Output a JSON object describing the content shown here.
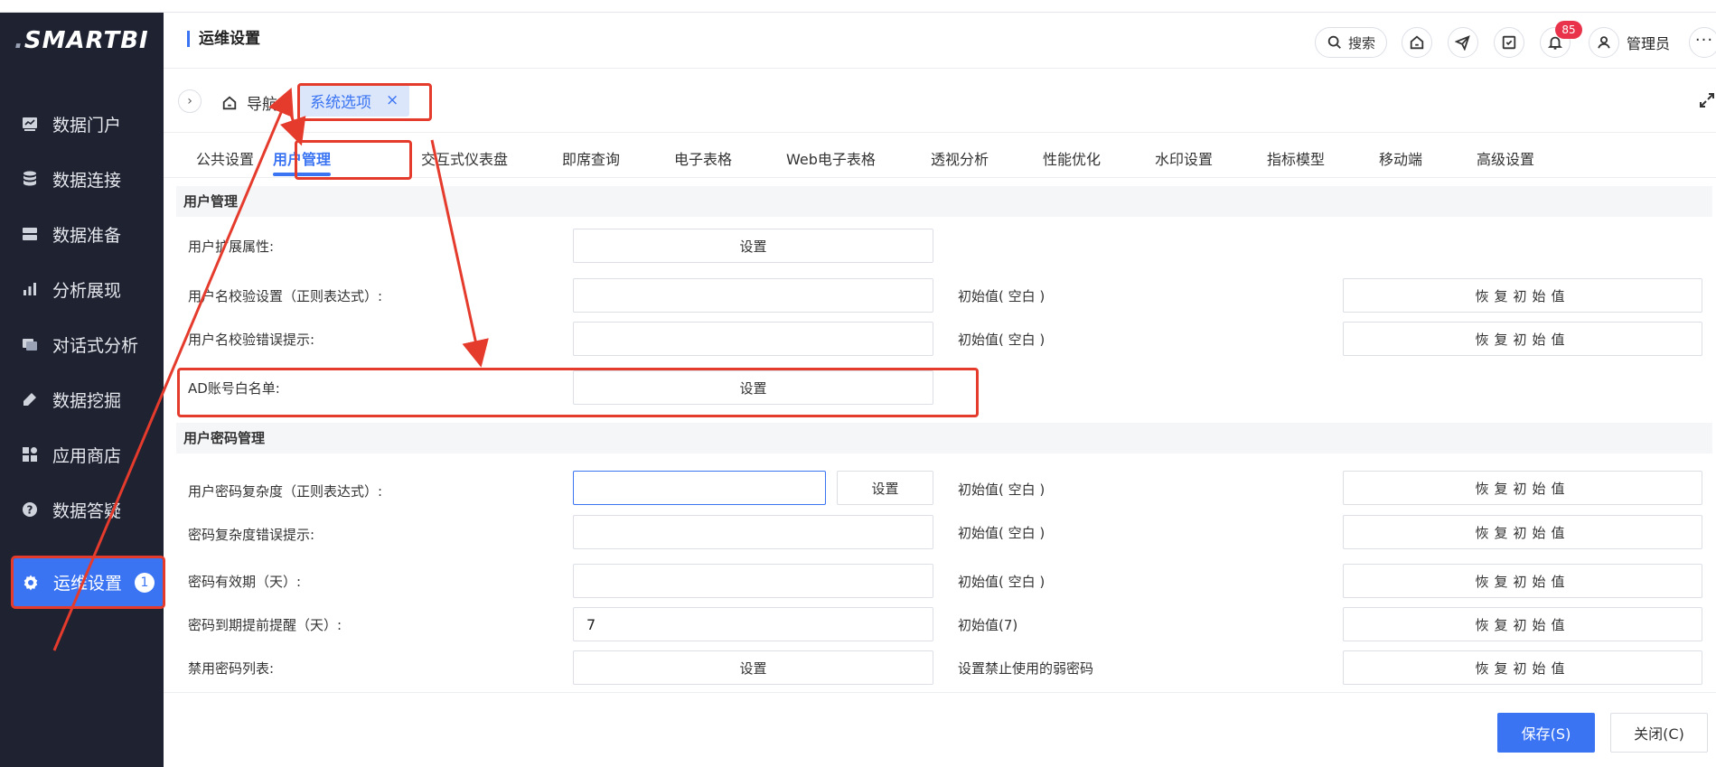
{
  "brand": {
    "logo": "SMARTBI"
  },
  "sidebar": {
    "items": [
      {
        "label": "数据门户",
        "icon": "dashboard-icon"
      },
      {
        "label": "数据连接",
        "icon": "database-icon"
      },
      {
        "label": "数据准备",
        "icon": "server-icon"
      },
      {
        "label": "分析展现",
        "icon": "bar-chart-icon"
      },
      {
        "label": "对话式分析",
        "icon": "chat-icon"
      },
      {
        "label": "数据挖掘",
        "icon": "pickaxe-icon"
      },
      {
        "label": "应用商店",
        "icon": "apps-icon"
      },
      {
        "label": "数据答疑",
        "icon": "question-icon"
      },
      {
        "label": "运维设置",
        "icon": "gear-icon",
        "badge": "1"
      }
    ]
  },
  "header": {
    "title": "运维设置",
    "search_label": "搜索",
    "notification_count": "85",
    "user": "管理员"
  },
  "breadcrumb": {
    "home": "导航",
    "open_tab": "系统选项",
    "close": "×"
  },
  "settings_tabs": [
    "公共设置",
    "用户管理",
    "交互式仪表盘",
    "即席查询",
    "电子表格",
    "Web电子表格",
    "透视分析",
    "性能优化",
    "水印设置",
    "指标模型",
    "移动端",
    "高级设置"
  ],
  "sections": {
    "user_mgmt": "用户管理",
    "password_mgmt": "用户密码管理"
  },
  "rows": {
    "ext_attr": {
      "label": "用户扩展属性:",
      "button": "设置"
    },
    "name_regex": {
      "label": "用户名校验设置（正则表达式）:",
      "value": "",
      "init": "初始值( 空白 )",
      "restore": "恢复初始值"
    },
    "name_error": {
      "label": "用户名校验错误提示:",
      "value": "",
      "init": "初始值( 空白 )",
      "restore": "恢复初始值"
    },
    "ad_whitelist": {
      "label": "AD账号白名单:",
      "button": "设置"
    },
    "pwd_regex": {
      "label": "用户密码复杂度（正则表达式）:",
      "value": "",
      "button": "设置",
      "init": "初始值( 空白 )",
      "restore": "恢复初始值"
    },
    "pwd_error": {
      "label": "密码复杂度错误提示:",
      "value": "",
      "init": "初始值( 空白 )",
      "restore": "恢复初始值"
    },
    "pwd_expire": {
      "label": "密码有效期（天）:",
      "value": "",
      "init": "初始值( 空白 )",
      "restore": "恢复初始值"
    },
    "pwd_remind": {
      "label": "密码到期提前提醒（天）:",
      "value": "7",
      "init": "初始值(7)",
      "restore": "恢复初始值"
    },
    "pwd_blacklist": {
      "label": "禁用密码列表:",
      "button": "设置",
      "init": "设置禁止使用的弱密码",
      "restore": "恢复初始值"
    }
  },
  "footer": {
    "save": "保存(S)",
    "close": "关闭(C)"
  },
  "colors": {
    "accent": "#3a74f2",
    "sidebar_bg": "#1e2231",
    "annotation": "#e53b2d",
    "badge": "#e8334a"
  }
}
